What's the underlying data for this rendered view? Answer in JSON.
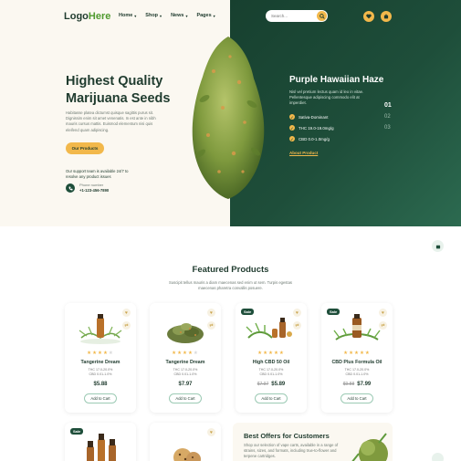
{
  "header": {
    "logo_main": "Logo",
    "logo_accent": "Here",
    "nav": [
      "Home",
      "Shop",
      "News",
      "Pages"
    ],
    "search_placeholder": "Search...",
    "icons": [
      "search-icon",
      "heart-icon",
      "cart-icon"
    ]
  },
  "hero": {
    "title": "Highest Quality Marijuana Seeds",
    "description": "Habitasse platea dictumst quisque sagittis purus sit. Dignissim enim sit amet venenatis. In est ante in nibh mauris cursus mattis. Euismod elementum nisi quis eleifend quam adipiscing.",
    "cta": "Our Products",
    "support": "Our support team is available 24/7 to resolve any product issues",
    "phone_label": "Phone number",
    "phone": "+1-123-456-7890"
  },
  "featured_slide": {
    "name": "Purple Hawaiian Haze",
    "description": "Nisl vel pretium lectus quam id leo in vitae. Pellentesque adipiscing commodo elit at imperdiet.",
    "specs": [
      "Sativa-Dominant",
      "THC 19.0-19.0mg/g",
      "CBD 0.0-1.0mg/g"
    ],
    "link": "About Product",
    "slides": [
      "01",
      "02",
      "03"
    ]
  },
  "featured": {
    "title": "Featured Products",
    "subtitle": "Suscipit tellus mauris a diam maecenas sed enim ut sem. Turpis egestas maecenas pharetra convallis posuere."
  },
  "products": [
    {
      "name": "Tangerine Dream",
      "thc": "THC 17.0-20.0%",
      "cbd": "CBD 0.01-1.0%",
      "price": "$5.88",
      "old_price": "",
      "sale": "",
      "rating": 4
    },
    {
      "name": "Tangerine Dream",
      "thc": "THC 17.0-20.0%",
      "cbd": "CBD 0.01-1.0%",
      "price": "$7.97",
      "old_price": "",
      "sale": "",
      "rating": 4
    },
    {
      "name": "High CBD 50 Oil",
      "thc": "THC 17.0-20.0%",
      "cbd": "CBD 0.01-1.0%",
      "price": "$5.89",
      "old_price": "$7.97",
      "sale": "Sale",
      "rating": 5
    },
    {
      "name": "CBD Plus Formula Oil",
      "thc": "THC 17.0-20.0%",
      "cbd": "CBD 0.01-1.0%",
      "price": "$7.99",
      "old_price": "$9.88",
      "sale": "Sale",
      "rating": 5
    }
  ],
  "card_labels": {
    "add_to_cart": "Add to Cart"
  },
  "second_row": {
    "sale": "Sale"
  },
  "offer": {
    "title": "Best Offers for Customers",
    "description": "Shop our selection of vape carts, available in a range of strains, sizes, and formats, including true-to-flower and terpene cartridges."
  },
  "colors": {
    "brand_dark": "#1e4e3a",
    "accent_gold": "#f2b84b",
    "brand_green": "#4f9a2f"
  }
}
